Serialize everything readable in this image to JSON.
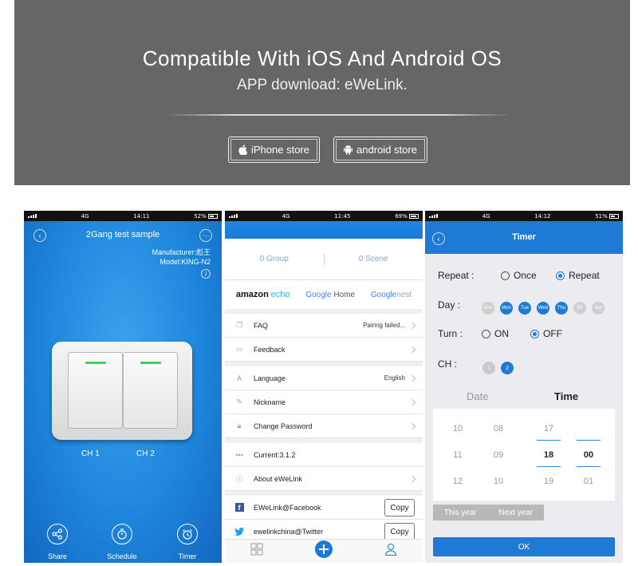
{
  "banner": {
    "title": "Compatible With iOS And Android OS",
    "subtitle": "APP download: eWeLink.",
    "buttons": {
      "ios_label": "iPhone store",
      "android_label": "android store"
    }
  },
  "phone1": {
    "status": {
      "carrier": "4G",
      "time": "14:11",
      "battery": "52%",
      "battery_level": 0.52
    },
    "title": "2Gang test sample",
    "manufacturer": "Manufacturer:彪王",
    "model": "Model:KING-N2",
    "channels": [
      "CH 1",
      "CH 2"
    ],
    "bottom": {
      "share": "Share",
      "schedule": "Schedule",
      "timer": "Timer"
    }
  },
  "phone2": {
    "status": {
      "carrier": "4G",
      "time": "11:45",
      "battery": "69%",
      "battery_level": 0.69
    },
    "tabs": {
      "group": "0 Group",
      "scene": "0 Scene"
    },
    "brands": {
      "amazon": "amazon",
      "echo": "echo",
      "google_home_1": "Google",
      "google_home_2": "Home",
      "google_nest_1": "Google",
      "google_nest_2": "nest"
    },
    "rows": {
      "faq": "FAQ",
      "faq_value": "Pairing failed...",
      "feedback": "Feedback",
      "language": "Language",
      "language_value": "English",
      "nickname": "Nickname",
      "change_password": "Change Password",
      "current": "Current:3.1.2",
      "about": "About eWeLink",
      "facebook": "EWeLink@Facebook",
      "twitter": "ewelinkchina@Twitter",
      "copy": "Copy"
    }
  },
  "phone3": {
    "status": {
      "carrier": "4G",
      "time": "14:12",
      "battery": "51%",
      "battery_level": 0.51
    },
    "title": "Timer",
    "repeat_label": "Repeat :",
    "once": "Once",
    "repeat": "Repeat",
    "day_label": "Day :",
    "days": [
      "Sun",
      "Mon",
      "Tue",
      "Wed",
      "Thu",
      "Fri",
      "Sat"
    ],
    "turn_label": "Turn :",
    "on": "ON",
    "off": "OFF",
    "ch_label": "CH :",
    "ch_options": [
      "1",
      "2"
    ],
    "date_header": "Date",
    "time_header": "Time",
    "picker": {
      "date_col1": [
        "10",
        "11",
        "12"
      ],
      "date_col2": [
        "08",
        "09",
        "10"
      ],
      "hour": [
        "17",
        "18",
        "19"
      ],
      "minute": [
        "00",
        "01"
      ]
    },
    "this_year": "This year",
    "next_year": "Next year",
    "ok": "OK"
  }
}
